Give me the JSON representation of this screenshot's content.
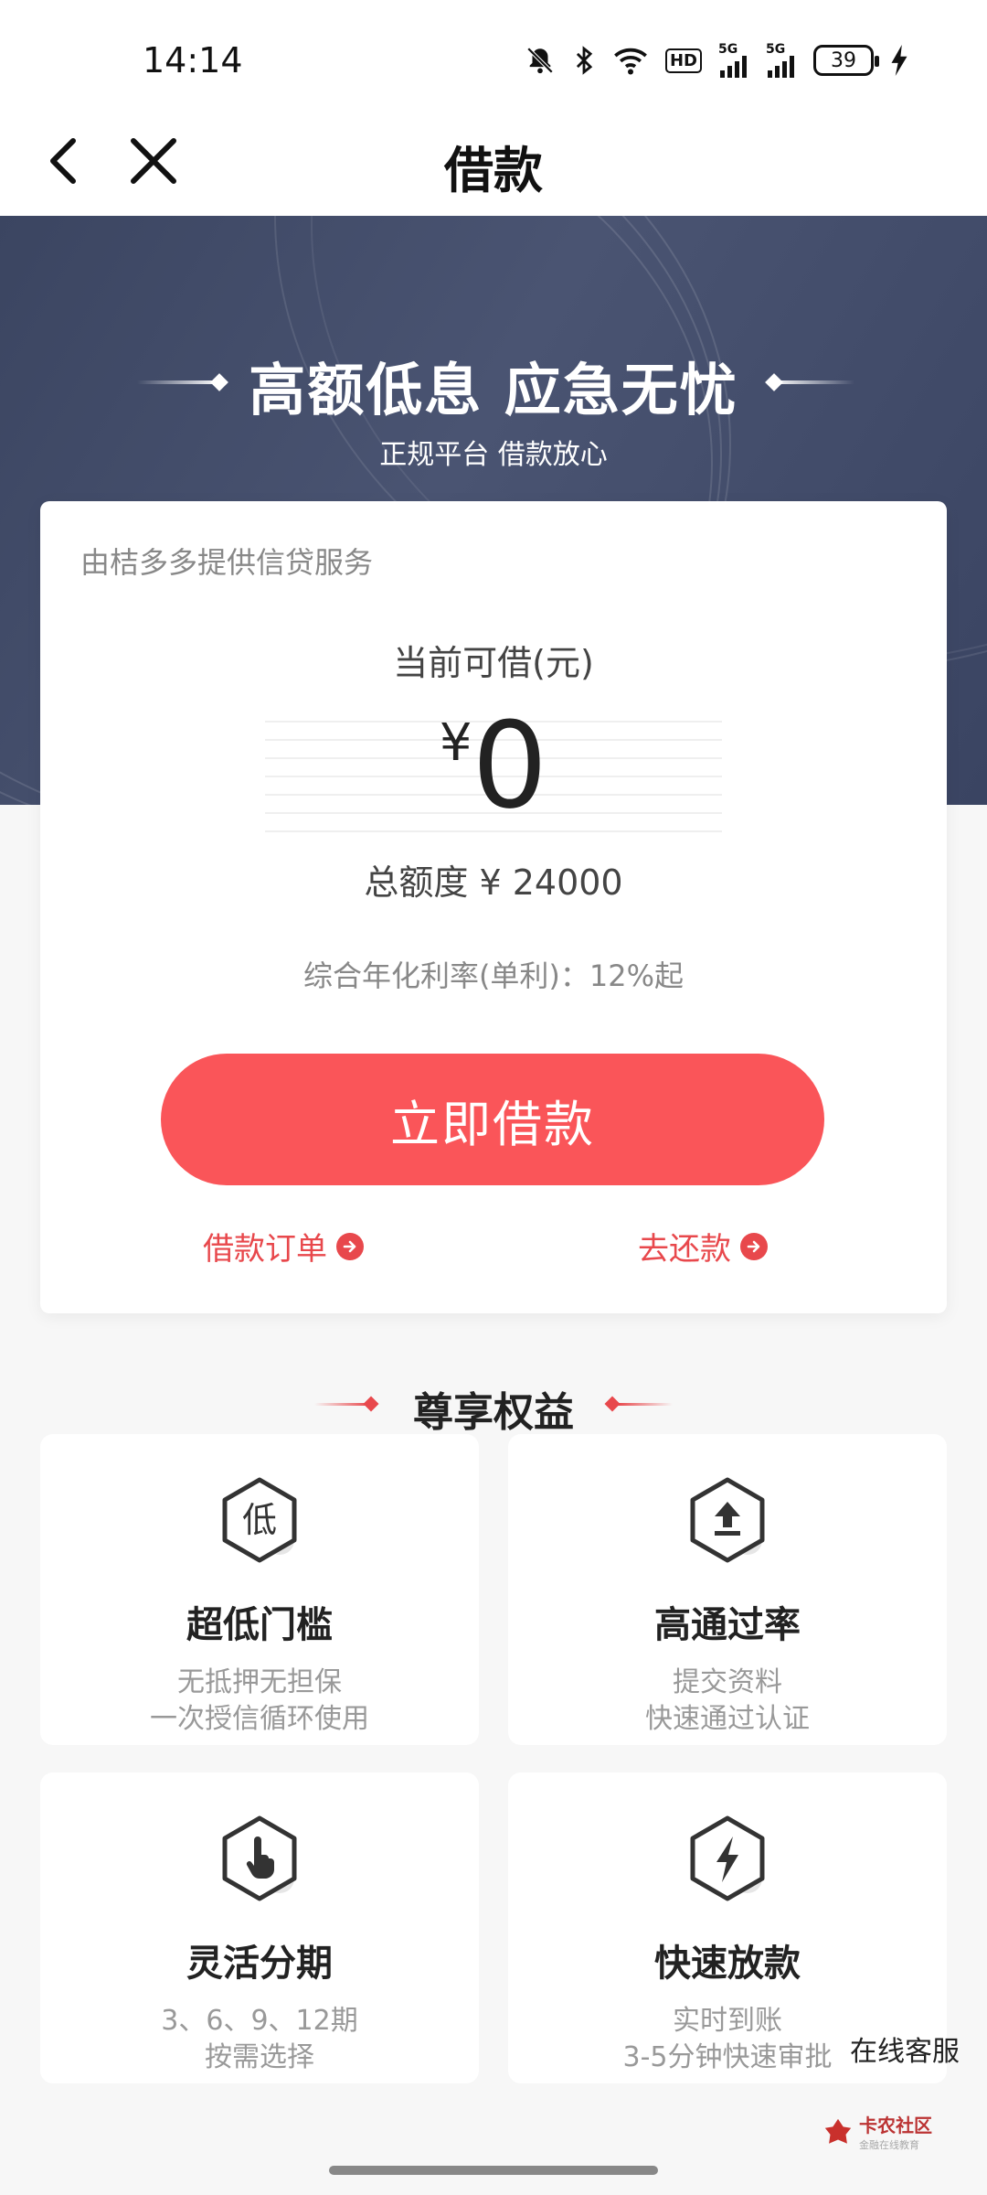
{
  "status_bar": {
    "time": "14:14",
    "battery": "39",
    "hd_label": "HD",
    "network_1": "5G",
    "network_2": "5G"
  },
  "nav": {
    "title": "借款"
  },
  "hero": {
    "title": "高额低息 应急无忧",
    "subtitle": "正规平台 借款放心"
  },
  "card": {
    "provider": "由桔多多提供信贷服务",
    "available_label": "当前可借(元)",
    "currency": "¥",
    "available_amount": "0",
    "total_limit": "总额度 ¥ 24000",
    "rate": "综合年化利率(单利)：12%起",
    "borrow_button": "立即借款",
    "orders_link": "借款订单",
    "repay_link": "去还款"
  },
  "benefits": {
    "title": "尊享权益",
    "items": [
      {
        "icon_char": "低",
        "icon": "low-threshold-icon",
        "name": "超低门槛",
        "desc1": "无抵押无担保",
        "desc2": "一次授信循环使用"
      },
      {
        "icon": "upload-arrow-icon",
        "name": "高通过率",
        "desc1": "提交资料",
        "desc2": "快速通过认证"
      },
      {
        "icon": "hand-tap-icon",
        "name": "灵活分期",
        "desc1": "3、6、9、12期",
        "desc2": "按需选择"
      },
      {
        "icon": "lightning-icon",
        "name": "快速放款",
        "desc1": "实时到账",
        "desc2": "3-5分钟快速审批"
      }
    ]
  },
  "service_link": "在线客服",
  "watermark": {
    "name": "卡农社区",
    "sub": "金融在线教育"
  },
  "colors": {
    "accent": "#fa5559",
    "link": "#e8484c",
    "hero_bg": "#414b68"
  }
}
